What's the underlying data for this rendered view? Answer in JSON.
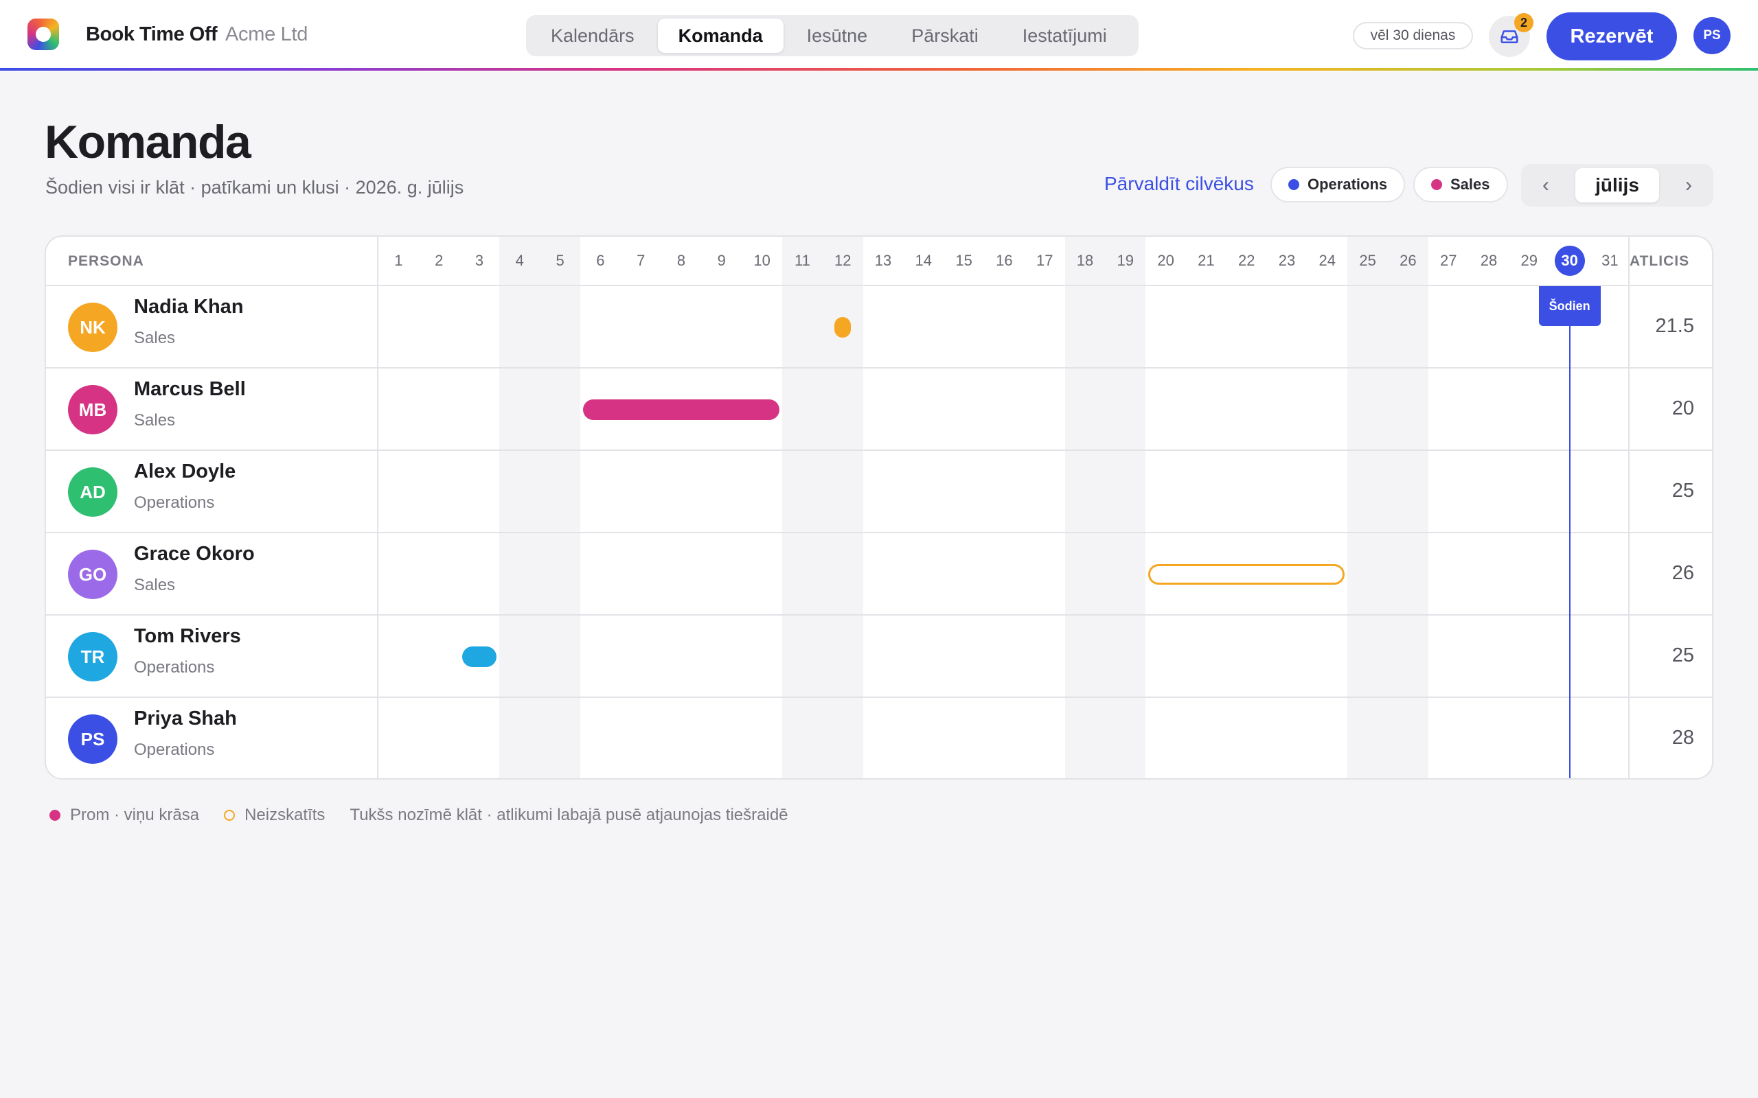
{
  "app": {
    "name": "Book Time Off",
    "org": "Acme Ltd"
  },
  "nav": {
    "tabs": [
      "Kalendārs",
      "Komanda",
      "Iesūtne",
      "Pārskati",
      "Iestatījumi"
    ],
    "active": "Komanda"
  },
  "topbar": {
    "trial": "vēl 30 dienas",
    "inbox_count": "2",
    "book_label": "Rezervēt",
    "user_initials": "PS"
  },
  "header": {
    "title": "Komanda",
    "subtitle": "Šodien visi ir klāt · patīkami un klusi · 2026. g. jūlijs",
    "manage_link": "Pārvaldīt cilvēkus",
    "filters": [
      {
        "label": "Operations",
        "color": "#3b4fe4"
      },
      {
        "label": "Sales",
        "color": "#d63384"
      }
    ],
    "month": "jūlijs",
    "prev": "‹",
    "next": "›"
  },
  "grid": {
    "person_header": "PERSONA",
    "remaining_header": "ATLICIS",
    "days": [
      "1",
      "2",
      "3",
      "4",
      "5",
      "6",
      "7",
      "8",
      "9",
      "10",
      "11",
      "12",
      "13",
      "14",
      "15",
      "16",
      "17",
      "18",
      "19",
      "20",
      "21",
      "22",
      "23",
      "24",
      "25",
      "26",
      "27",
      "28",
      "29",
      "30",
      "31"
    ],
    "today": "30",
    "today_label": "Šodien",
    "weekend_days": [
      4,
      5,
      11,
      12,
      18,
      19,
      25,
      26
    ],
    "people": [
      {
        "initials": "NK",
        "name": "Nadia Khan",
        "team": "Sales",
        "remaining": "21.5",
        "avatar_color": "#f5a623",
        "leaves": [
          {
            "start": 12,
            "end": 12,
            "half": true,
            "style": "filled",
            "color": "#f5a623"
          }
        ]
      },
      {
        "initials": "MB",
        "name": "Marcus Bell",
        "team": "Sales",
        "remaining": "20",
        "avatar_color": "#d63384",
        "leaves": [
          {
            "start": 6,
            "end": 10,
            "style": "filled",
            "color": "#d63384"
          }
        ]
      },
      {
        "initials": "AD",
        "name": "Alex Doyle",
        "team": "Operations",
        "remaining": "25",
        "avatar_color": "#2fbf71",
        "leaves": []
      },
      {
        "initials": "GO",
        "name": "Grace Okoro",
        "team": "Sales",
        "remaining": "26",
        "avatar_color": "#9b6ae8",
        "leaves": [
          {
            "start": 20,
            "end": 24,
            "style": "outline",
            "color": "#f5a623"
          }
        ]
      },
      {
        "initials": "TR",
        "name": "Tom Rivers",
        "team": "Operations",
        "remaining": "25",
        "avatar_color": "#1ea7e1",
        "leaves": [
          {
            "start": 3,
            "end": 3,
            "style": "filled",
            "color": "#1ea7e1"
          }
        ]
      },
      {
        "initials": "PS",
        "name": "Priya Shah",
        "team": "Operations",
        "remaining": "28",
        "avatar_color": "#3b4fe4",
        "leaves": []
      }
    ]
  },
  "legend": {
    "away": "Prom · viņu krāsa",
    "pending": "Neizskatīts",
    "note": "Tukšs nozīmē klāt · atlikumi labajā pusē atjaunojas tiešraidē",
    "away_color": "#d63384",
    "pending_color": "#f5a623"
  },
  "icons": {
    "logo": "app-logo-icon",
    "inbox": "inbox-icon"
  }
}
